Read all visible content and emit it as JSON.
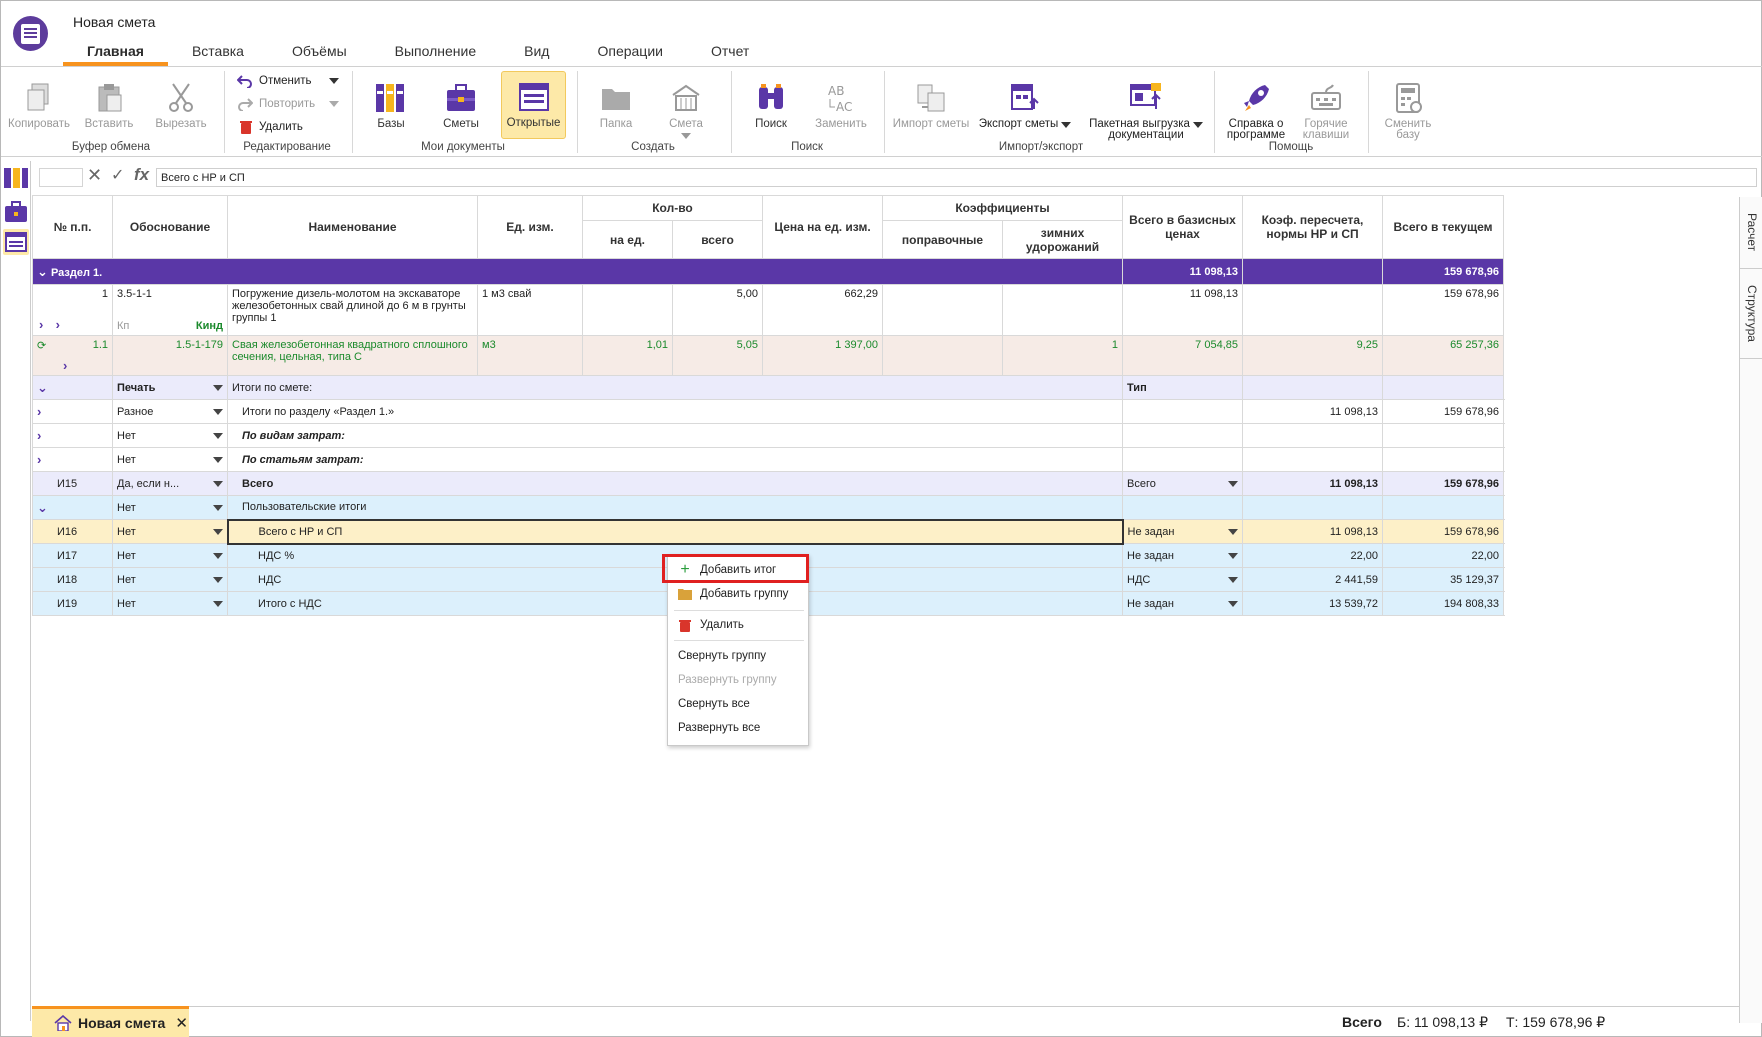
{
  "window": {
    "title": "Новая смета"
  },
  "menu_tabs": [
    {
      "label": "Главная",
      "active": true
    },
    {
      "label": "Вставка"
    },
    {
      "label": "Объёмы"
    },
    {
      "label": "Выполнение"
    },
    {
      "label": "Вид"
    },
    {
      "label": "Операции"
    },
    {
      "label": "Отчет"
    }
  ],
  "ribbon": {
    "clipboard": {
      "copy": "Копировать",
      "paste": "Вставить",
      "cut": "Вырезать",
      "group": "Буфер обмена"
    },
    "editing": {
      "undo": "Отменить",
      "redo": "Повторить",
      "delete": "Удалить",
      "group": "Редактирование"
    },
    "my_docs": {
      "bases": "Базы",
      "estimates": "Сметы",
      "open": "Открытые",
      "group": "Мои документы"
    },
    "create": {
      "folder": "Папка",
      "estimate": "Смета",
      "group": "Создать"
    },
    "search": {
      "search": "Поиск",
      "replace": "Заменить",
      "group": "Поиск"
    },
    "import_export": {
      "import": "Импорт сметы",
      "export": "Экспорт сметы",
      "batch": "Пакетная выгрузка",
      "batch2": "документации",
      "group": "Импорт/экспорт"
    },
    "help": {
      "help": "Справка о",
      "help2": "программе",
      "hotkeys": "Горячие",
      "hotkeys2": "клавиши",
      "group": "Помощь"
    },
    "change_base": {
      "label": "Сменить",
      "label2": "базу"
    },
    "colors": {
      "accent": "#5a37a7",
      "orange": "#f7931e",
      "active_bg": "#fde9a8"
    }
  },
  "formula_bar": {
    "value": "Всего с НР и СП"
  },
  "right_tabs": [
    "Расчет",
    "Структура"
  ],
  "headers": {
    "num": "№ п.п.",
    "basis": "Обоснование",
    "name": "Наименование",
    "unit": "Ед. изм.",
    "qty": "Кол-во",
    "qty_per": "на ед.",
    "qty_total": "всего",
    "price": "Цена на ед. изм.",
    "coef": "Коэффициенты",
    "coef_corr": "поправочные",
    "coef_winter": "зимних удорожаний",
    "total_base": "Всего в базисных ценах",
    "coef_recalc": "Коэф. пересчета, нормы НР и СП",
    "total_current": "Всего в текущем"
  },
  "section": {
    "label": "Раздел 1.",
    "total_base": "11 098,13",
    "total_current": "159 678,96"
  },
  "item1": {
    "num": "1",
    "basis": "3.5-1-1",
    "kp": "Кп",
    "kind": "Кинд",
    "name": "Погружение дизель-молотом на экскаваторе железобетонных свай длиной до 6 м в грунты группы 1",
    "unit": "1 м3 свай",
    "qty_total": "5,00",
    "price": "662,29",
    "total_base": "11 098,13",
    "total_current": "159 678,96"
  },
  "item2": {
    "num": "1.1",
    "basis": "1.5-1-179",
    "name": "Свая железобетонная квадратного сплошного сечения, цельная, типа С",
    "unit": "м3",
    "qty_per": "1,01",
    "qty_total": "5,05",
    "price": "1 397,00",
    "coef_winter": "1",
    "total_base": "7 054,85",
    "coef_recalc": "9,25",
    "total_current": "65 257,36"
  },
  "totals_header": {
    "print": "Печать",
    "label": "Итоги по смете:",
    "type": "Тип"
  },
  "totals": [
    {
      "print": "Разное",
      "label": "Итоги по разделу «Раздел 1.»",
      "total_base": "11 098,13",
      "total_current": "159 678,96"
    },
    {
      "print": "Нет",
      "label": "По видам затрат:"
    },
    {
      "print": "Нет",
      "label": "По статьям затрат:"
    }
  ],
  "total_all": {
    "code": "И15",
    "print": "Да, если н...",
    "label": "Всего",
    "type": "Всего",
    "total_base": "11 098,13",
    "total_current": "159 678,96"
  },
  "user_totals_header": {
    "print": "Нет",
    "label": "Пользовательские итоги"
  },
  "user_totals": [
    {
      "code": "И16",
      "print": "Нет",
      "label": "Всего с НР и СП",
      "type": "Не задан",
      "total_base": "11 098,13",
      "total_current": "159 678,96"
    },
    {
      "code": "И17",
      "print": "Нет",
      "label": "НДС %",
      "type": "Не задан",
      "total_base": "22,00",
      "total_current": "22,00"
    },
    {
      "code": "И18",
      "print": "Нет",
      "label": "НДС",
      "type": "НДС",
      "total_base": "2 441,59",
      "total_current": "35 129,37"
    },
    {
      "code": "И19",
      "print": "Нет",
      "label": "Итого с НДС",
      "type": "Не задан",
      "total_base": "13 539,72",
      "total_current": "194 808,33"
    }
  ],
  "context_menu": {
    "add_total": "Добавить итог",
    "add_group": "Добавить группу",
    "delete": "Удалить",
    "collapse_group": "Свернуть группу",
    "expand_group": "Развернуть группу",
    "collapse_all": "Свернуть все",
    "expand_all": "Развернуть все"
  },
  "bottom": {
    "doc_tab": "Новая смета",
    "total_label": "Всего",
    "base": "Б: 11 098,13 ₽",
    "current": "Т: 159 678,96 ₽"
  }
}
